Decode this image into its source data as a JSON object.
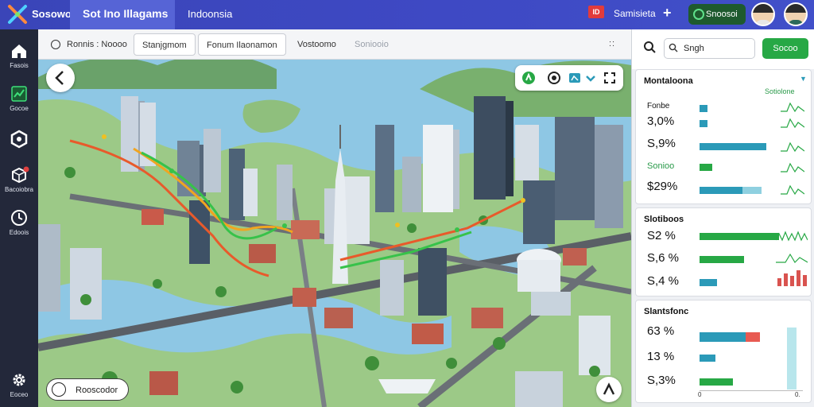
{
  "app": {
    "name": "Sosowo",
    "title": "Sot Ino Illagams",
    "region": "Indoonsia"
  },
  "topbar": {
    "search_label": "Samisieta",
    "status_label": "Snoosoi"
  },
  "sidebar": {
    "items": [
      {
        "label": "Fasois",
        "icon": "home-icon"
      },
      {
        "label": "Gocoe",
        "icon": "chart-icon"
      },
      {
        "label": "",
        "icon": "hexagon-icon"
      },
      {
        "label": "Bacoiobra",
        "icon": "cube-icon"
      },
      {
        "label": "Edoois",
        "icon": "clock-icon"
      }
    ],
    "settings_label": "Eoceo"
  },
  "tabs": [
    {
      "label": "Ronnis : Noooo"
    },
    {
      "label": "Stanjgmom"
    },
    {
      "label": "Fonum Ilaonamon"
    },
    {
      "label": "Vostoomo"
    },
    {
      "label": "Soniooio"
    }
  ],
  "map": {
    "bottom_chip_label": "Rooscodor"
  },
  "panel": {
    "search_value": "Sngh",
    "search_button": "Socoo",
    "card1": {
      "title": "Montaloona",
      "subtitle": "Sotiolone",
      "row_label": "Fonbe",
      "metrics": [
        "3,0%",
        "S,9%",
        "Sonioo",
        "$29%"
      ]
    },
    "card2": {
      "title": "Slotiboos",
      "metrics": [
        "S2 %",
        "S,6 %",
        "S,4 %"
      ]
    },
    "card3": {
      "title": "Slantsfonc",
      "metrics": [
        "63 %",
        "13 %",
        "S,3%"
      ],
      "axis_left": "0",
      "axis_right": "0."
    }
  },
  "colors": {
    "accent": "#3e49c4",
    "green": "#27a845",
    "teal": "#2b9ab8",
    "red": "#d9534f"
  }
}
